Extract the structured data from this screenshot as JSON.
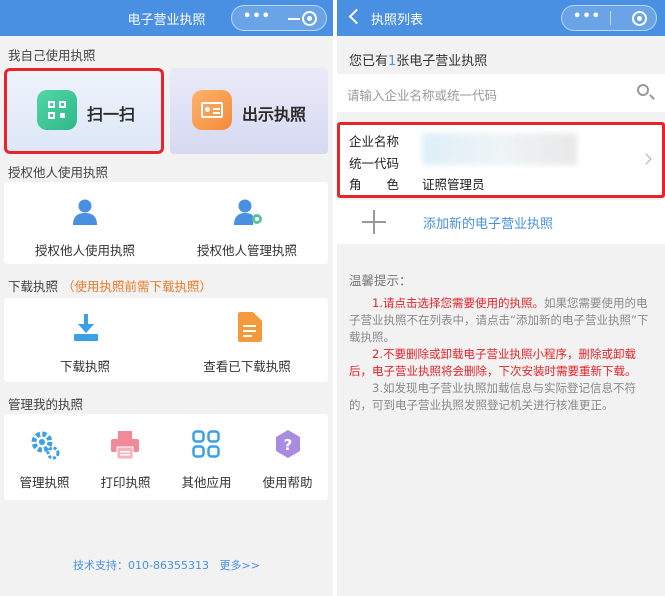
{
  "left": {
    "nav": {
      "title": "电子营业执照",
      "menu_dots": "•••"
    },
    "sections": {
      "my_use": "我自己使用执照",
      "authorize": "授权他人使用执照",
      "download": "下载执照",
      "download_note": "（使用执照前需下载执照）",
      "manage": "管理我的执照"
    },
    "big_buttons": {
      "scan": "扫一扫",
      "show": "出示执照"
    },
    "authorize_items": [
      "授权他人使用执照",
      "授权他人管理执照"
    ],
    "download_items": [
      "下载执照",
      "查看已下载执照"
    ],
    "manage_items": [
      "管理执照",
      "打印执照",
      "其他应用",
      "使用帮助"
    ],
    "footer": {
      "support": "技术支持：010-86355313",
      "more": "更多>>"
    },
    "colors": {
      "brand": "#4a90e2",
      "highlight": "#e8232a",
      "note": "#f07a28"
    }
  },
  "right": {
    "nav": {
      "title": "执照列表",
      "menu_dots": "•••"
    },
    "count": {
      "prefix": "您已有",
      "number": "1",
      "suffix": "张电子营业执照"
    },
    "search": {
      "placeholder": "请输入企业名称或统一代码"
    },
    "license": {
      "name_label": "企业名称",
      "code_label": "统一代码",
      "role_label": "角　　色",
      "role_value": "证照管理员"
    },
    "add_label": "添加新的电子营业执照",
    "tips": {
      "title": "温馨提示：",
      "t1_red": "1.请点击选择您需要使用的执照。",
      "t1_rest": "如果您需要使用的电子营业执照不在列表中，请点击“添加新的电子营业执照”下载执照。",
      "t2": "2.不要删除或卸载电子营业执照小程序，删除或卸载后，电子营业执照将会删除，下次安装时需要重新下载。",
      "t3": "3.如发现电子营业执照加载信息与实际登记信息不符的，可到电子营业执照发照登记机关进行核准更正。"
    }
  }
}
